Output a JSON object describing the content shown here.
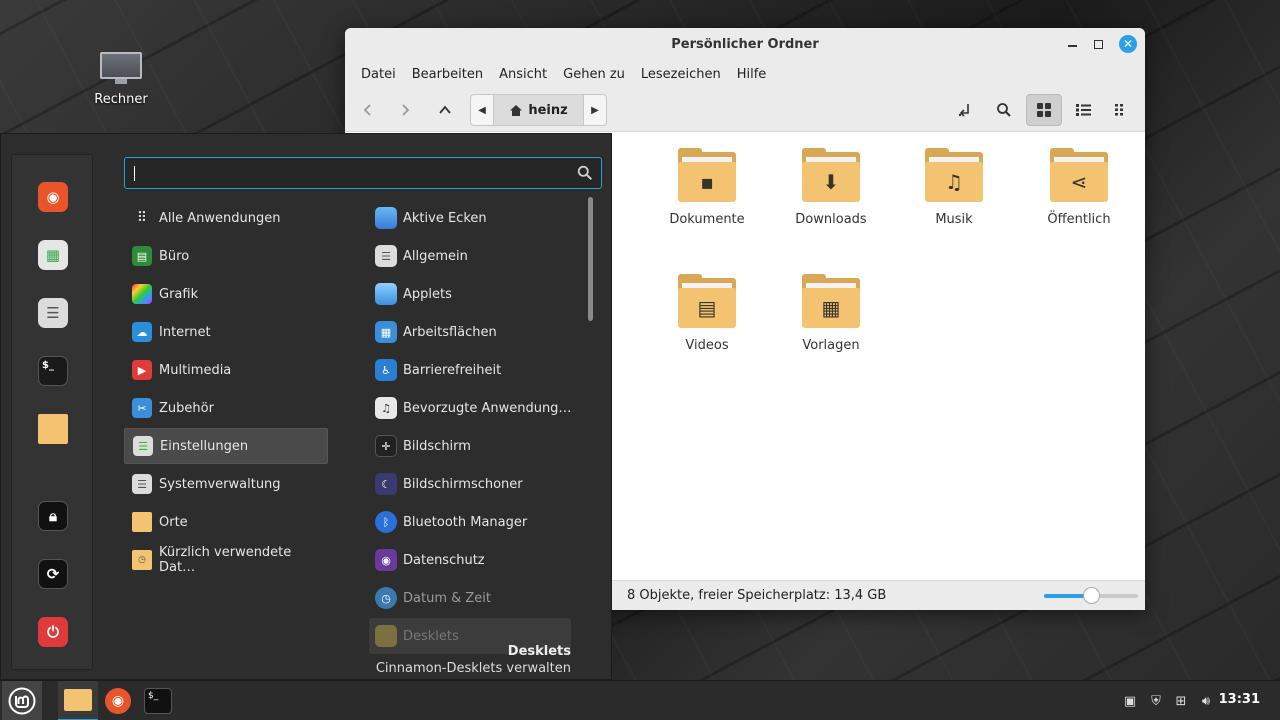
{
  "desktop": {
    "icon_label": "Rechner"
  },
  "filemanager": {
    "title": "Persönlicher Ordner",
    "menu": [
      "Datei",
      "Bearbeiten",
      "Ansicht",
      "Gehen zu",
      "Lesezeichen",
      "Hilfe"
    ],
    "breadcrumb": "heinz",
    "folders": [
      {
        "name": "Dokumente",
        "glyph": "▪"
      },
      {
        "name": "Downloads",
        "glyph": "⬇"
      },
      {
        "name": "Musik",
        "glyph": "♫"
      },
      {
        "name": "Öffentlich",
        "glyph": "⋖"
      },
      {
        "name": "Videos",
        "glyph": "▤"
      },
      {
        "name": "Vorlagen",
        "glyph": "▦"
      }
    ],
    "status": "8 Objekte, freier Speicherplatz: 13,4 GB",
    "zoom_level": 0.5
  },
  "menu": {
    "search_placeholder": "",
    "categories": [
      {
        "label": "Alle Anwendungen",
        "icon": "grid-icon",
        "color": "transparent"
      },
      {
        "label": "Büro",
        "icon": "office-icon",
        "color": "#2e8b3a"
      },
      {
        "label": "Grafik",
        "icon": "graphics-icon",
        "color": "#c040c0"
      },
      {
        "label": "Internet",
        "icon": "internet-icon",
        "color": "#2a8ed8"
      },
      {
        "label": "Multimedia",
        "icon": "multimedia-icon",
        "color": "#e03b3b"
      },
      {
        "label": "Zubehör",
        "icon": "accessories-icon",
        "color": "#3a8fd8"
      },
      {
        "label": "Einstellungen",
        "icon": "settings-icon",
        "color": "#dcdcdc"
      },
      {
        "label": "Systemverwaltung",
        "icon": "admin-icon",
        "color": "#dcdcdc"
      },
      {
        "label": "Orte",
        "icon": "folder-icon",
        "color": "#f3c371"
      },
      {
        "label": "Kürzlich verwendete Dat…",
        "icon": "recent-icon",
        "color": "#f3c371"
      }
    ],
    "apps": [
      {
        "label": "Aktive Ecken",
        "color": "#4a9be8"
      },
      {
        "label": "Allgemein",
        "color": "#dcdcdc"
      },
      {
        "label": "Applets",
        "color": "#5ab0f0"
      },
      {
        "label": "Arbeitsflächen",
        "color": "#3a8fd8"
      },
      {
        "label": "Barrierefreiheit",
        "color": "#2a7fd4"
      },
      {
        "label": "Bevorzugte Anwendung…",
        "color": "#e8e8e8"
      },
      {
        "label": "Bildschirm",
        "color": "#222222"
      },
      {
        "label": "Bildschirmschoner",
        "color": "#3a3a70"
      },
      {
        "label": "Bluetooth Manager",
        "color": "#2a70d8"
      },
      {
        "label": "Datenschutz",
        "color": "#6a3a9a"
      },
      {
        "label": "Datum & Zeit",
        "color": "#3a7ab0"
      },
      {
        "label": "Desklets",
        "color": "#7a7040"
      }
    ],
    "description_title": "Desklets",
    "description_sub": "Cinnamon-Desklets verwalten"
  },
  "taskbar": {
    "clock": "13:31"
  }
}
